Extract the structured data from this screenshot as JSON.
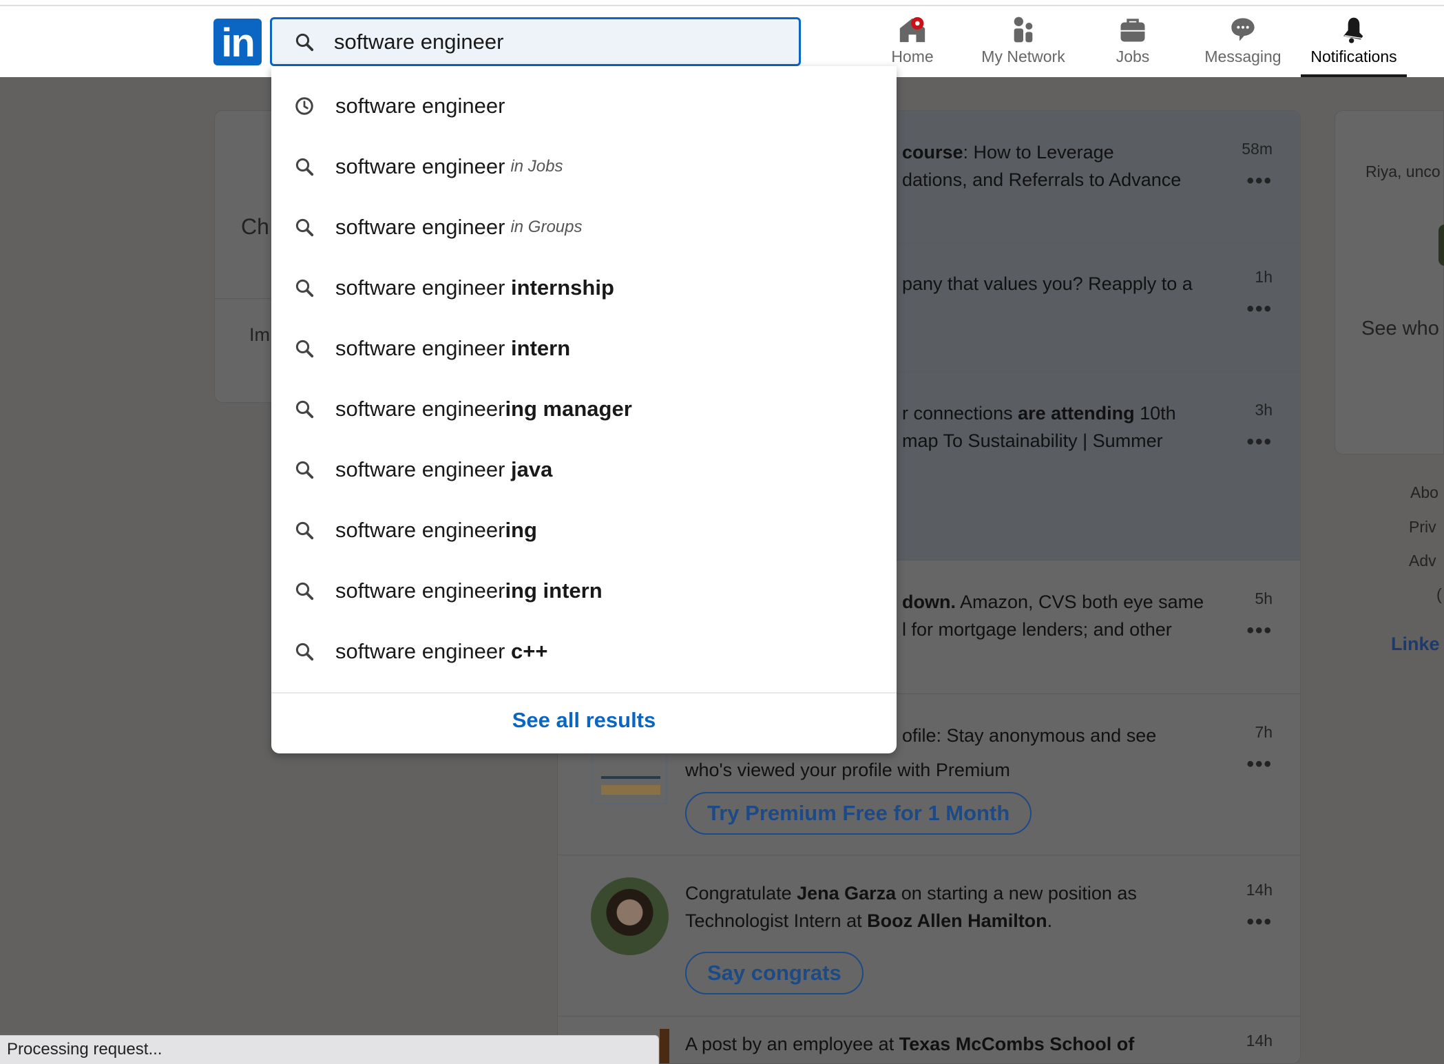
{
  "header": {
    "logo": "in",
    "search": {
      "value": "software engineer"
    },
    "nav": [
      {
        "label": "Home",
        "icon": "home-icon",
        "badge": true
      },
      {
        "label": "My Network",
        "icon": "people-icon"
      },
      {
        "label": "Jobs",
        "icon": "briefcase-icon"
      },
      {
        "label": "Messaging",
        "icon": "chat-icon"
      },
      {
        "label": "Notifications",
        "icon": "bell-icon",
        "active": true
      }
    ]
  },
  "dropdown": {
    "suggestions": [
      {
        "icon": "clock-icon",
        "base": "software engineer",
        "bold": "",
        "context": ""
      },
      {
        "icon": "search-icon",
        "base": "software engineer",
        "bold": "",
        "context": "in Jobs"
      },
      {
        "icon": "search-icon",
        "base": "software engineer",
        "bold": "",
        "context": "in Groups"
      },
      {
        "icon": "search-icon",
        "base": "software engineer ",
        "bold": "internship",
        "context": ""
      },
      {
        "icon": "search-icon",
        "base": "software engineer ",
        "bold": "intern",
        "context": ""
      },
      {
        "icon": "search-icon",
        "base": "software engineer",
        "bold": "ing manager",
        "context": ""
      },
      {
        "icon": "search-icon",
        "base": "software engineer ",
        "bold": "java",
        "context": ""
      },
      {
        "icon": "search-icon",
        "base": "software engineer",
        "bold": "ing",
        "context": ""
      },
      {
        "icon": "search-icon",
        "base": "software engineer",
        "bold": "ing intern",
        "context": ""
      },
      {
        "icon": "search-icon",
        "base": "software engineer ",
        "bold": "c++",
        "context": ""
      }
    ],
    "see_all": "See all results"
  },
  "left_card": {
    "line1": "Ch",
    "line2": "Im"
  },
  "notifications": [
    {
      "bold": "course",
      "rest": ": How to Leverage",
      "line2": "dations, and Referrals to Advance",
      "time": "58m"
    },
    {
      "line1": "pany that values you? Reapply to a",
      "time": "1h"
    },
    {
      "pre": "r connections ",
      "bold": "are attending",
      "rest": " 10th",
      "line2": "map To Sustainability | Summer",
      "time": "3h"
    },
    {
      "bold": "down.",
      "rest": " Amazon, CVS both eye same",
      "line2": "l for mortgage lenders; and other",
      "time": "5h"
    },
    {
      "line1": "ofile: Stay anonymous and see",
      "line2": "who's viewed your profile with Premium",
      "button": "Try Premium Free for 1 Month",
      "time": "7h"
    },
    {
      "pre": "Congratulate ",
      "bold": "Jena Garza",
      "rest": " on starting a new position as",
      "line2pre": "Technologist Intern at ",
      "line2bold": "Booz Allen Hamilton",
      "line2rest": ".",
      "button": "Say congrats",
      "time": "14h"
    },
    {
      "pre": "A post by an employee at ",
      "bold": "Texas McCombs School of",
      "time": "14h"
    }
  ],
  "right_card": {
    "line1": "Riya, unco",
    "line2": "See who"
  },
  "footer": [
    "Abo",
    "Priv",
    "Adv",
    "(",
    "Linke"
  ],
  "status": "Processing request...",
  "colors": {
    "brand": "#0a66c2",
    "badge": "#cc1016"
  }
}
